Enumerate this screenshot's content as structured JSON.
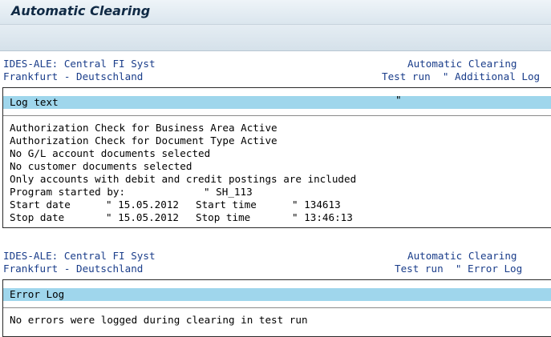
{
  "window": {
    "title": "Automatic Clearing"
  },
  "section1": {
    "header": {
      "left1": "IDES-ALE: Central FI Syst",
      "left2": "Frankfurt - Deutschland",
      "right1": "Automatic Clearing",
      "right2": "Test run  \" Additional Log"
    },
    "bar_label": "Log text",
    "bar_mark": "\"",
    "lines": [
      "Authorization Check for Business Area Active",
      "Authorization Check for Document Type Active",
      "No G/L account documents selected",
      "No customer documents selected",
      "Only accounts with debit and credit postings are included"
    ],
    "program_label": "Program started by:",
    "program_value": "\" SH_113",
    "start_date_label": "Start date",
    "start_date_value": "\" 15.05.2012",
    "start_time_label": "Start time",
    "start_time_value": "\" 134613",
    "stop_date_label": "Stop date",
    "stop_date_value": "\" 15.05.2012",
    "stop_time_label": "Stop time",
    "stop_time_value": "\" 13:46:13"
  },
  "section2": {
    "header": {
      "left1": "IDES-ALE: Central FI Syst",
      "left2": "Frankfurt - Deutschland",
      "right1": "Automatic Clearing",
      "right2": "Test run  \" Error Log"
    },
    "bar_label": "Error Log",
    "message": "No errors were logged during clearing in test run"
  }
}
